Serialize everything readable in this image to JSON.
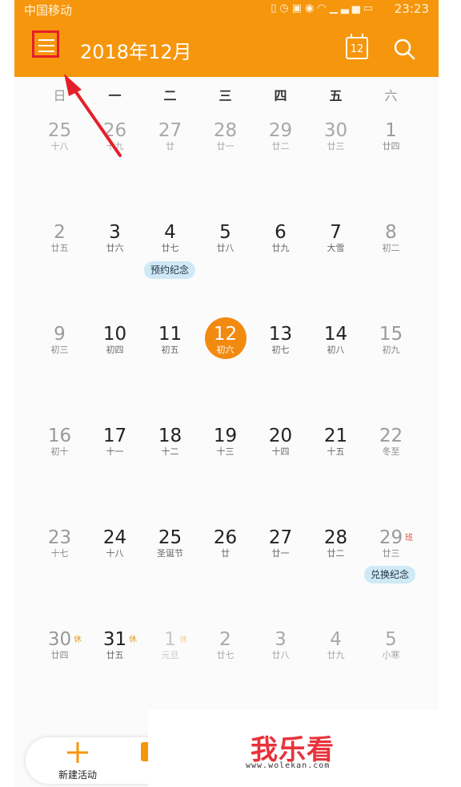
{
  "status_bar": {
    "carrier": "中国移动",
    "icons": [
      "vibrate-icon",
      "alarm-icon",
      "hd-icon",
      "eye-icon",
      "wifi-icon",
      "signal-icon",
      "battery-icon"
    ],
    "time": "23:23"
  },
  "header": {
    "menu_icon": "hamburger-menu-icon",
    "title": "2018年12月",
    "today_label": "12",
    "today_icon": "calendar-today-icon",
    "search_icon": "search-icon"
  },
  "weekdays": [
    "日",
    "一",
    "二",
    "三",
    "四",
    "五",
    "六"
  ],
  "weeks": [
    [
      {
        "d": "25",
        "l": "十八",
        "s": "dim"
      },
      {
        "d": "26",
        "l": "十九",
        "s": "dim"
      },
      {
        "d": "27",
        "l": "廿",
        "s": "dim"
      },
      {
        "d": "28",
        "l": "廿一",
        "s": "dim"
      },
      {
        "d": "29",
        "l": "廿二",
        "s": "dim"
      },
      {
        "d": "30",
        "l": "廿三",
        "s": "dim"
      },
      {
        "d": "1",
        "l": "廿四",
        "s": "weekend"
      }
    ],
    [
      {
        "d": "2",
        "l": "廿五",
        "s": "weekend"
      },
      {
        "d": "3",
        "l": "廿六"
      },
      {
        "d": "4",
        "l": "廿七"
      },
      {
        "d": "5",
        "l": "廿八"
      },
      {
        "d": "6",
        "l": "廿九"
      },
      {
        "d": "7",
        "l": "大雪"
      },
      {
        "d": "8",
        "l": "初二",
        "s": "weekend"
      }
    ],
    [
      {
        "d": "9",
        "l": "初三",
        "s": "weekend"
      },
      {
        "d": "10",
        "l": "初四"
      },
      {
        "d": "11",
        "l": "初五"
      },
      {
        "d": "12",
        "l": "初六",
        "s": "today"
      },
      {
        "d": "13",
        "l": "初七"
      },
      {
        "d": "14",
        "l": "初八"
      },
      {
        "d": "15",
        "l": "初九",
        "s": "weekend"
      }
    ],
    [
      {
        "d": "16",
        "l": "初十",
        "s": "weekend"
      },
      {
        "d": "17",
        "l": "十一"
      },
      {
        "d": "18",
        "l": "十二"
      },
      {
        "d": "19",
        "l": "十三"
      },
      {
        "d": "20",
        "l": "十四"
      },
      {
        "d": "21",
        "l": "十五"
      },
      {
        "d": "22",
        "l": "冬至",
        "s": "weekend"
      }
    ],
    [
      {
        "d": "23",
        "l": "十七",
        "s": "weekend"
      },
      {
        "d": "24",
        "l": "十八"
      },
      {
        "d": "25",
        "l": "圣诞节"
      },
      {
        "d": "26",
        "l": "廿"
      },
      {
        "d": "27",
        "l": "廿一"
      },
      {
        "d": "28",
        "l": "廿二"
      },
      {
        "d": "29",
        "l": "廿三",
        "s": "weekend",
        "m": "班",
        "mt": "work"
      }
    ],
    [
      {
        "d": "30",
        "l": "廿四",
        "s": "weekend",
        "m": "休",
        "mt": "rest"
      },
      {
        "d": "31",
        "l": "廿五",
        "m": "休",
        "mt": "rest"
      },
      {
        "d": "1",
        "l": "元旦",
        "s": "faint",
        "m": "休",
        "mt": "pale"
      },
      {
        "d": "2",
        "l": "廿七",
        "s": "dim"
      },
      {
        "d": "3",
        "l": "廿八",
        "s": "dim"
      },
      {
        "d": "4",
        "l": "廿九",
        "s": "dim"
      },
      {
        "d": "5",
        "l": "小寒",
        "s": "dim"
      }
    ]
  ],
  "events": {
    "dec4": "预约纪念",
    "dec29": "兑换纪念"
  },
  "bottom_bar": {
    "new_event_label": "新建活动",
    "new_event_icon": "plus-icon"
  },
  "watermark": {
    "logo": "我乐看",
    "url": "www.wolekan.com"
  },
  "colors": {
    "accent": "#f6960c",
    "today_circle": "#f28a0f",
    "annotation_red": "#e4202a",
    "event_pill": "#cfe9f6"
  }
}
